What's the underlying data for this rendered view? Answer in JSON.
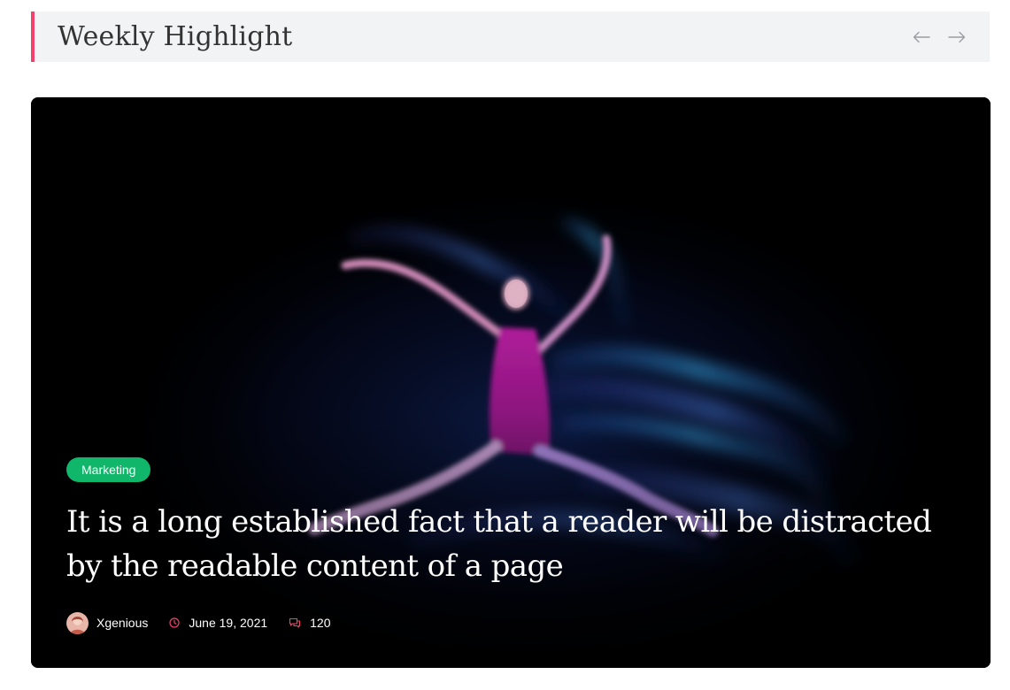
{
  "section": {
    "title": "Weekly Highlight",
    "prev_icon": "arrow-left-icon",
    "next_icon": "arrow-right-icon"
  },
  "card": {
    "category": "Marketing",
    "title": "It is a long established fact that a reader will be distracted by the readable content of a page",
    "author": "Xgenious",
    "date": "June 19, 2021",
    "comments": "120",
    "date_icon": "clock-icon",
    "comment_icon": "comment-icon"
  },
  "colors": {
    "accent": "#f2416b",
    "badge": "#10b76a",
    "header_bg": "#f2f3f5",
    "card_bg": "#000000"
  }
}
